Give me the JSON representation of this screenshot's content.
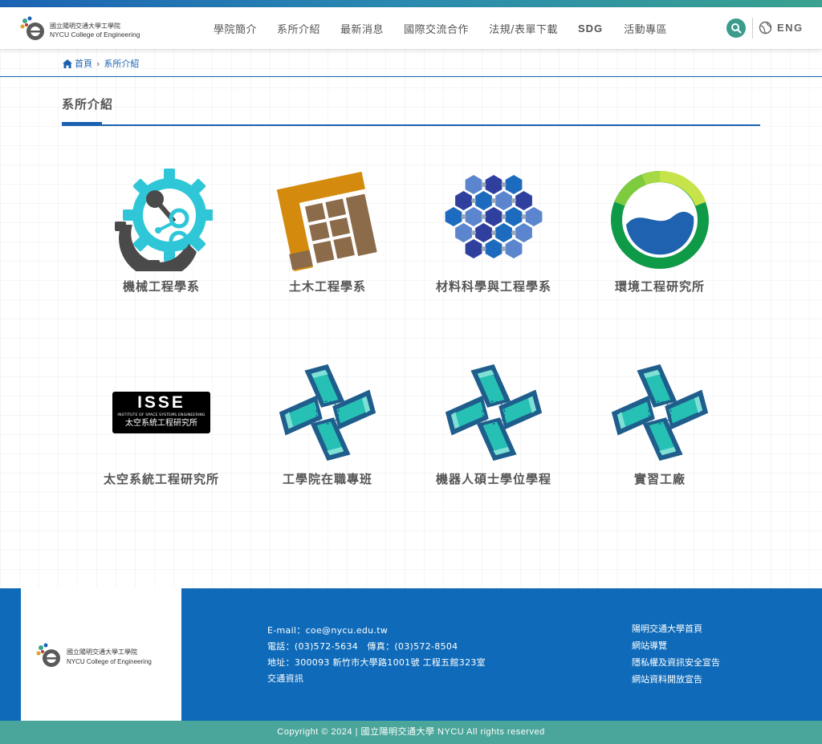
{
  "header": {
    "logo_zh": "國立陽明交通大學工學院",
    "logo_en": "NYCU College of Engineering",
    "nav": [
      {
        "label": "學院簡介"
      },
      {
        "label": "系所介紹"
      },
      {
        "label": "最新消息"
      },
      {
        "label": "國際交流合作"
      },
      {
        "label": "法規/表單下載"
      },
      {
        "label": "SDG"
      },
      {
        "label": "活動專區"
      }
    ],
    "search_icon": "search-icon",
    "lang_icon": "globe-icon",
    "lang_label": "ENG"
  },
  "breadcrumb": {
    "home": "首頁",
    "separator": "›",
    "current": "系所介紹"
  },
  "page_title": "系所介紹",
  "departments": [
    {
      "label": "機械工程學系",
      "icon": "gear-icon"
    },
    {
      "label": "土木工程學系",
      "icon": "grid-block-icon"
    },
    {
      "label": "材料科學與工程學系",
      "icon": "hexagon-lattice-icon"
    },
    {
      "label": "環境工程研究所",
      "icon": "water-circle-icon"
    },
    {
      "label": "太空系統工程研究所",
      "icon": "isse-logo",
      "logo_title": "ISSE",
      "logo_sub_en": "INSTITUTE OF SPACE SYSTEMS ENGINEERING",
      "logo_sub_zh": "太空系統工程研究所"
    },
    {
      "label": "工學院在職專班",
      "icon": "pinwheel-icon"
    },
    {
      "label": "機器人碩士學位學程",
      "icon": "pinwheel-icon"
    },
    {
      "label": "實習工廠",
      "icon": "pinwheel-icon"
    }
  ],
  "footer": {
    "logo_zh": "國立陽明交通大學工學院",
    "logo_en": "NYCU College of Engineering",
    "email": "E-mail：coe@nycu.edu.tw",
    "phone": "電話：(03)572-5634   傳真：(03)572-8504",
    "address": "地址：300093 新竹市大學路1001號 工程五館323室",
    "traffic": "交通資訊",
    "links": [
      {
        "label": "陽明交通大學首頁"
      },
      {
        "label": "網站導覽"
      },
      {
        "label": "隱私權及資訊安全宣告"
      },
      {
        "label": "網站資料開放宣告"
      }
    ]
  },
  "copyright": "Copyright © 2024 | 國立陽明交通大學 NYCU All rights reserved",
  "colors": {
    "brand_blue": "#1a62b1",
    "footer_blue": "#0f6bb9",
    "teal": "#4aa59a"
  }
}
